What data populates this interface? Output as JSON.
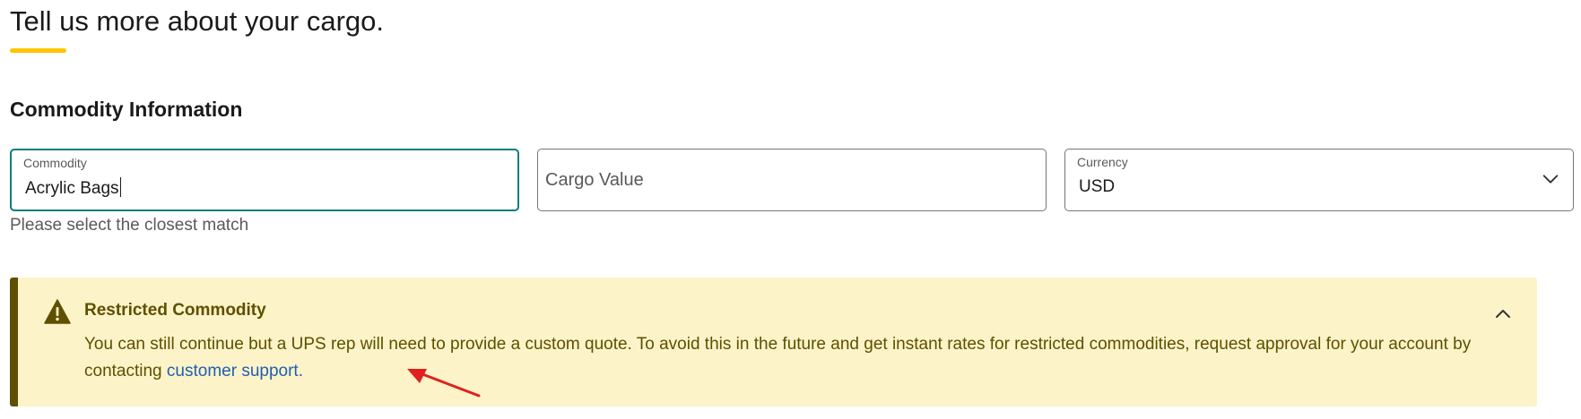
{
  "page": {
    "heading": "Tell us more about your cargo."
  },
  "section": {
    "title": "Commodity Information"
  },
  "fields": {
    "commodity": {
      "label": "Commodity",
      "value": "Acrylic Bags",
      "helper": "Please select the closest match"
    },
    "cargo_value": {
      "placeholder": "Cargo Value",
      "value": ""
    },
    "currency": {
      "label": "Currency",
      "value": "USD",
      "icon": "chevron-down-icon"
    }
  },
  "alert": {
    "title": "Restricted Commodity",
    "body": "You can still continue but a UPS rep will need to provide a custom quote. To avoid this in the future and get instant rates for restricted commodities, request approval for your account by contacting ",
    "link_text": "customer support.",
    "icon": "warning-icon",
    "collapse_icon": "chevron-up-icon"
  },
  "colors": {
    "accent_underline": "#ffc400",
    "focus_border": "#0b7d7b",
    "alert_background": "#fdf3c8",
    "alert_text": "#5e5000",
    "link": "#1f5fb4",
    "annotation_arrow": "#e0201e"
  }
}
